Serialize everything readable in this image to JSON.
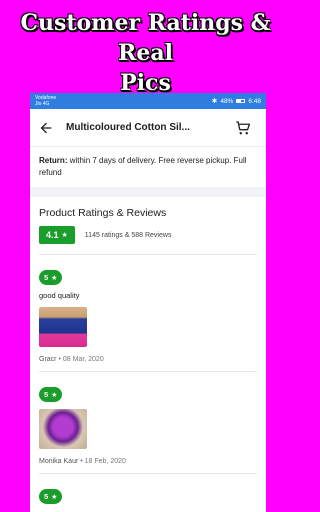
{
  "promo": {
    "line1": "Customer Ratings & Real",
    "line2": "Pics"
  },
  "status_bar": {
    "carrier_line1": "Vodafone",
    "carrier_line2": "Jio 4G",
    "battery": "48%",
    "time": "6:48"
  },
  "app_bar": {
    "title": "Multicoloured Cotton Sil..."
  },
  "return_policy": {
    "label": "Return:",
    "text": "within 7 days of delivery. Free reverse pickup. Full refund"
  },
  "reviews": {
    "title": "Product Ratings & Reviews",
    "average": "4.1",
    "summary": "1145 ratings & 588 Reviews",
    "items": [
      {
        "rating": "5",
        "text": "good quality",
        "author": "Gracr",
        "date": "08 Mar, 2020"
      },
      {
        "rating": "5",
        "text": "",
        "author": "Monika Kaur",
        "date": "18 Feb, 2020"
      },
      {
        "rating": "5"
      }
    ]
  },
  "icons": {
    "back": "back-arrow-icon",
    "cart": "cart-icon",
    "star": "star-icon"
  },
  "colors": {
    "background": "#ff00ff",
    "status_bar": "#2f7de0",
    "rating_badge": "#1a9d2b"
  }
}
